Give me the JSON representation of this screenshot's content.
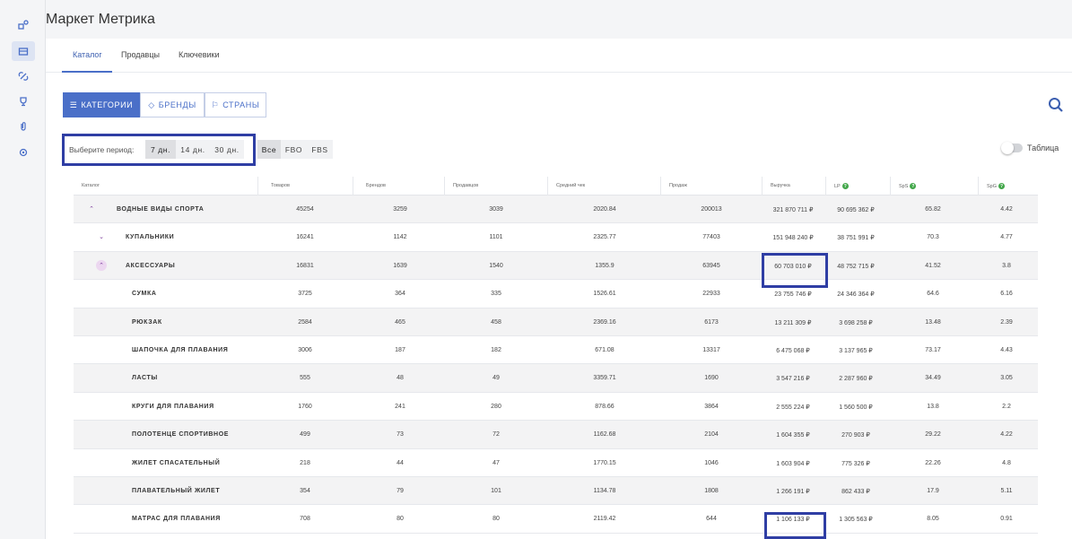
{
  "app": {
    "title": "Маркет Метрика"
  },
  "tabs": [
    {
      "label": "Каталог",
      "active": true
    },
    {
      "label": "Продавцы",
      "active": false
    },
    {
      "label": "Ключевики",
      "active": false
    }
  ],
  "segments": [
    {
      "label": "КАТЕГОРИИ",
      "icon": "list-icon",
      "active": true
    },
    {
      "label": "БРЕНДЫ",
      "icon": "tag-icon",
      "active": false
    },
    {
      "label": "СТРАНЫ",
      "icon": "flag-icon",
      "active": false
    }
  ],
  "period": {
    "label": "Выберите период:",
    "options": [
      "7 дн.",
      "14 дн.",
      "30 дн."
    ],
    "selected": "7 дн."
  },
  "fulfillment": {
    "options": [
      "Все",
      "FBO",
      "FBS"
    ],
    "selected": "Все"
  },
  "table_toggle": {
    "label": "Таблица",
    "on": false
  },
  "table": {
    "headers": [
      "Каталог",
      "Товаров",
      "Брендов",
      "Продавцов",
      "Средний чек",
      "Продаж",
      "Выручка",
      "LP",
      "SpS",
      "SpG"
    ],
    "rows": [
      {
        "name": "ВОДНЫЕ ВИДЫ СПОРТА",
        "level": 0,
        "chevron": "up",
        "cells": [
          "45254",
          "3259",
          "3039",
          "2020.84",
          "200013",
          "321 870 711 ₽",
          "90 695 362 ₽",
          "65.82",
          "4.42"
        ]
      },
      {
        "name": "КУПАЛЬНИКИ",
        "level": 1,
        "chevron": "down",
        "cells": [
          "16241",
          "1142",
          "1101",
          "2325.77",
          "77403",
          "151 948 240 ₽",
          "38 751 991 ₽",
          "70.3",
          "4.77"
        ]
      },
      {
        "name": "АКСЕССУАРЫ",
        "level": 1,
        "chevron": "up",
        "cells": [
          "16831",
          "1639",
          "1540",
          "1355.9",
          "63945",
          "60 703 010 ₽",
          "48 752 715 ₽",
          "41.52",
          "3.8"
        ]
      },
      {
        "name": "СУМКА",
        "level": 2,
        "chevron": "",
        "cells": [
          "3725",
          "364",
          "335",
          "1526.61",
          "22933",
          "23 755 746 ₽",
          "24 346 364 ₽",
          "64.6",
          "6.16"
        ]
      },
      {
        "name": "РЮКЗАК",
        "level": 2,
        "chevron": "",
        "cells": [
          "2584",
          "465",
          "458",
          "2369.16",
          "6173",
          "13 211 309 ₽",
          "3 698 258 ₽",
          "13.48",
          "2.39"
        ]
      },
      {
        "name": "ШАПОЧКА ДЛЯ ПЛАВАНИЯ",
        "level": 2,
        "chevron": "",
        "cells": [
          "3006",
          "187",
          "182",
          "671.08",
          "13317",
          "6 475 068 ₽",
          "3 137 965 ₽",
          "73.17",
          "4.43"
        ]
      },
      {
        "name": "ЛАСТЫ",
        "level": 2,
        "chevron": "",
        "cells": [
          "555",
          "48",
          "49",
          "3359.71",
          "1690",
          "3 547 216 ₽",
          "2 287 960 ₽",
          "34.49",
          "3.05"
        ]
      },
      {
        "name": "КРУГИ ДЛЯ ПЛАВАНИЯ",
        "level": 2,
        "chevron": "",
        "cells": [
          "1760",
          "241",
          "280",
          "878.66",
          "3864",
          "2 555 224 ₽",
          "1 560 500 ₽",
          "13.8",
          "2.2"
        ]
      },
      {
        "name": "ПОЛОТЕНЦЕ СПОРТИВНОЕ",
        "level": 2,
        "chevron": "",
        "cells": [
          "499",
          "73",
          "72",
          "1162.68",
          "2104",
          "1 604 355 ₽",
          "270 903 ₽",
          "29.22",
          "4.22"
        ]
      },
      {
        "name": "ЖИЛЕТ СПАСАТЕЛЬНЫЙ",
        "level": 2,
        "chevron": "",
        "cells": [
          "218",
          "44",
          "47",
          "1770.15",
          "1046",
          "1 603 904 ₽",
          "775 326 ₽",
          "22.26",
          "4.8"
        ]
      },
      {
        "name": "ПЛАВАТЕЛЬНЫЙ ЖИЛЕТ",
        "level": 2,
        "chevron": "",
        "cells": [
          "354",
          "79",
          "101",
          "1134.78",
          "1808",
          "1 266 191 ₽",
          "862 433 ₽",
          "17.9",
          "5.11"
        ]
      },
      {
        "name": "МАТРАС ДЛЯ ПЛАВАНИЯ",
        "level": 2,
        "chevron": "",
        "cells": [
          "708",
          "80",
          "80",
          "2119.42",
          "644",
          "1 106 133 ₽",
          "1 305 563 ₽",
          "8.05",
          "0.91"
        ]
      }
    ]
  },
  "colors": {
    "accent": "#4a6fc8",
    "highlight": "#2f3ea4",
    "help": "#42a74a"
  }
}
